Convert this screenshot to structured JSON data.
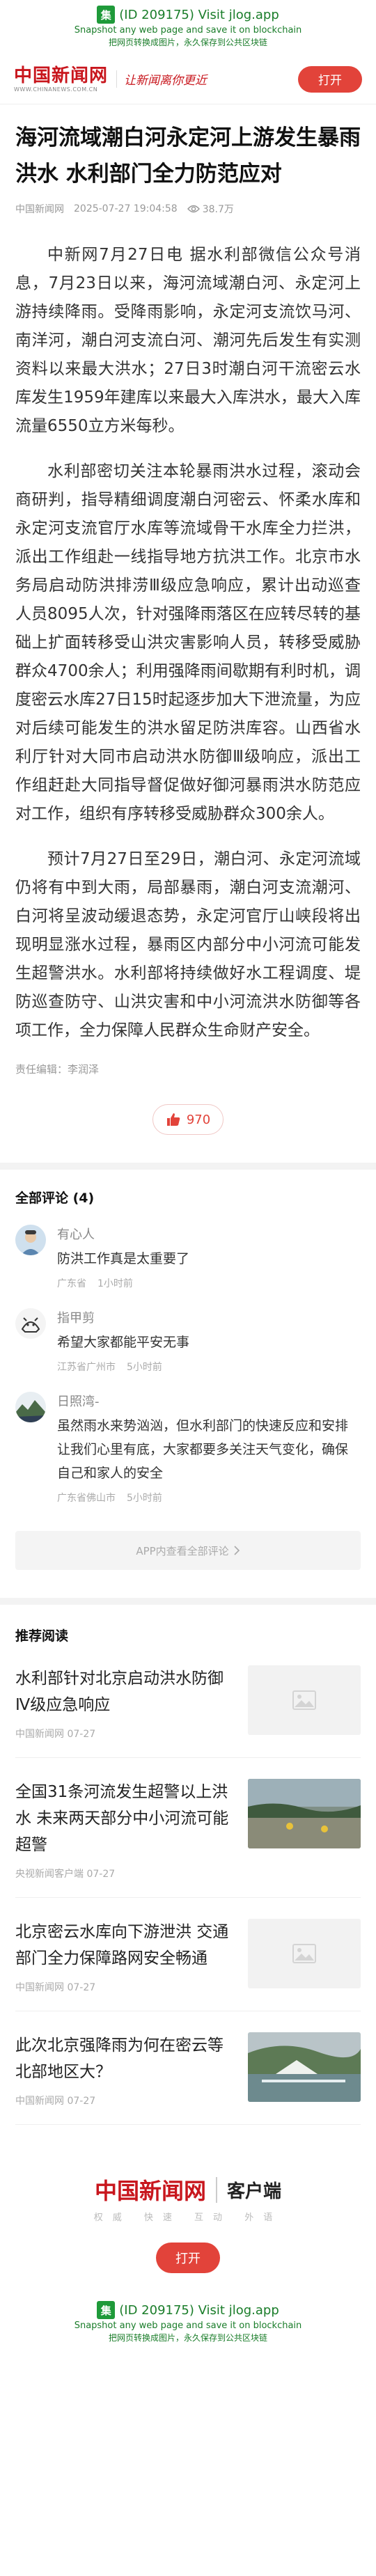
{
  "banner": {
    "logo_char": "集",
    "line1": "(ID 209175) Visit jlog.app",
    "line2": "Snapshot any web page and save it on blockchain",
    "line3": "把网页转换成图片，永久保存到公共区块链"
  },
  "header": {
    "logo": "中国新闻网",
    "logo_url": "WWW.CHINANEWS.COM.CN",
    "slogan": "让新闻离你更近",
    "open_label": "打开"
  },
  "article": {
    "title": "海河流域潮白河永定河上游发生暴雨洪水 水利部门全力防范应对",
    "source": "中国新闻网",
    "datetime": "2025-07-27 19:04:58",
    "views": "38.7万",
    "paragraphs": [
      "中新网7月27日电 据水利部微信公众号消息，7月23日以来，海河流域潮白河、永定河上游持续降雨。受降雨影响，永定河支流饮马河、南洋河，潮白河支流白河、潮河先后发生有实测资料以来最大洪水；27日3时潮白河干流密云水库发生1959年建库以来最大入库洪水，最大入库流量6550立方米每秒。",
      "水利部密切关注本轮暴雨洪水过程，滚动会商研判，指导精细调度潮白河密云、怀柔水库和永定河支流官厅水库等流域骨干水库全力拦洪，派出工作组赴一线指导地方抗洪工作。北京市水务局启动防洪排涝Ⅲ级应急响应，累计出动巡查人员8095人次，针对强降雨落区在应转尽转的基础上扩面转移受山洪灾害影响人员，转移受威胁群众4700余人；利用强降雨间歇期有利时机，调度密云水库27日15时起逐步加大下泄流量，为应对后续可能发生的洪水留足防洪库容。山西省水利厅针对大同市启动洪水防御Ⅲ级响应，派出工作组赶赴大同指导督促做好御河暴雨洪水防范应对工作，组织有序转移受威胁群众300余人。",
      "预计7月27日至29日，潮白河、永定河流域仍将有中到大雨，局部暴雨，潮白河支流潮河、白河将呈波动缓退态势，永定河官厅山峡段将出现明显涨水过程，暴雨区内部分中小河流可能发生超警洪水。水利部将持续做好水工程调度、堤防巡查防守、山洪灾害和中小河流洪水防御等各项工作，全力保障人民群众生命财产安全。"
    ],
    "editor": "责任编辑：李润泽",
    "likes": "970"
  },
  "comments": {
    "title": "全部评论 (4)",
    "items": [
      {
        "name": "有心人",
        "text": "防洪工作真是太重要了",
        "location": "广东省",
        "time": "1小时前"
      },
      {
        "name": "指甲剪",
        "text": "希望大家都能平安无事",
        "location": "江苏省广州市",
        "time": "5小时前"
      },
      {
        "name": "日照湾-",
        "text": "虽然雨水来势汹汹，但水利部门的快速反应和安排让我们心里有底，大家都要多关注天气变化，确保自己和家人的安全",
        "location": "广东省佛山市",
        "time": "5小时前"
      }
    ],
    "more_label": "APP内查看全部评论"
  },
  "recommend": {
    "title": "推荐阅读",
    "items": [
      {
        "headline": "水利部针对北京启动洪水防御Ⅳ级应急响应",
        "meta": "中国新闻网 07-27"
      },
      {
        "headline": "全国31条河流发生超警以上洪水 未来两天部分中小河流可能超警",
        "meta": "央视新闻客户端 07-27"
      },
      {
        "headline": "北京密云水库向下游泄洪 交通部门全力保障路网安全畅通",
        "meta": "中国新闻网 07-27"
      },
      {
        "headline": "此次北京强降雨为何在密云等北部地区大？",
        "meta": "中国新闻网 07-27"
      }
    ]
  },
  "footer": {
    "logo": "中国新闻网",
    "app_label": "客户端",
    "tags": "权威 快速 互动 外语",
    "open_label": "打开"
  },
  "colors": {
    "accent": "#e2433a",
    "brand": "#c8161d",
    "jlog": "#1f9a3a"
  }
}
